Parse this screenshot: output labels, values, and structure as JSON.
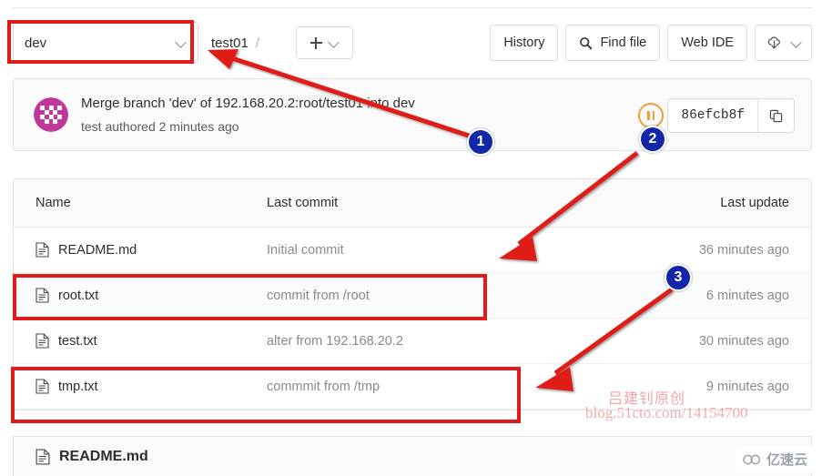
{
  "toolbar": {
    "branch": {
      "value": "dev",
      "icon": "chevron-down-icon"
    },
    "breadcrumb": {
      "repo": "test01",
      "separator": "/"
    },
    "add_button": {
      "label": "+",
      "icon": "plus-icon"
    },
    "buttons": [
      {
        "label": "History",
        "icon": null
      },
      {
        "label": "Find file",
        "icon": "search-icon"
      },
      {
        "label": "Web IDE",
        "icon": null
      }
    ],
    "download_button": {
      "icon": "download-cloud-icon",
      "chevron": "chevron-down-icon"
    }
  },
  "commit": {
    "message": "Merge branch 'dev' of 192.168.20.2:root/test01 into dev",
    "meta": "test authored 2 minutes ago",
    "author": "test",
    "sha": "86efcb8f",
    "copy_icon": "copy-icon",
    "pipeline_status": "pending",
    "avatar": "identicon-avatar"
  },
  "file_table": {
    "columns": {
      "name": "Name",
      "last_commit": "Last commit",
      "last_update": "Last update"
    },
    "rows": [
      {
        "name": "README.md",
        "icon": "file-icon",
        "last_commit": "Initial commit",
        "last_update": "36 minutes ago"
      },
      {
        "name": "root.txt",
        "icon": "file-icon",
        "last_commit": "commit from /root",
        "last_update": "6 minutes ago"
      },
      {
        "name": "test.txt",
        "icon": "file-icon",
        "last_commit": "alter from 192.168.20.2",
        "last_update": "30 minutes ago"
      },
      {
        "name": "tmp.txt",
        "icon": "file-icon",
        "last_commit": "commmit from /tmp",
        "last_update": "9 minutes ago"
      }
    ]
  },
  "readme_footer": {
    "title": "README.md",
    "icon": "file-icon"
  },
  "annotations": {
    "markers": [
      {
        "label": "1"
      },
      {
        "label": "2"
      },
      {
        "label": "3"
      }
    ],
    "box_color": "#e01b19",
    "marker_color": "#1226a8"
  },
  "watermark": {
    "chinese": "吕建钊原创",
    "url": "blog.51cto.com/14154700",
    "brand": "亿速云",
    "color": "#f4a9ae"
  }
}
